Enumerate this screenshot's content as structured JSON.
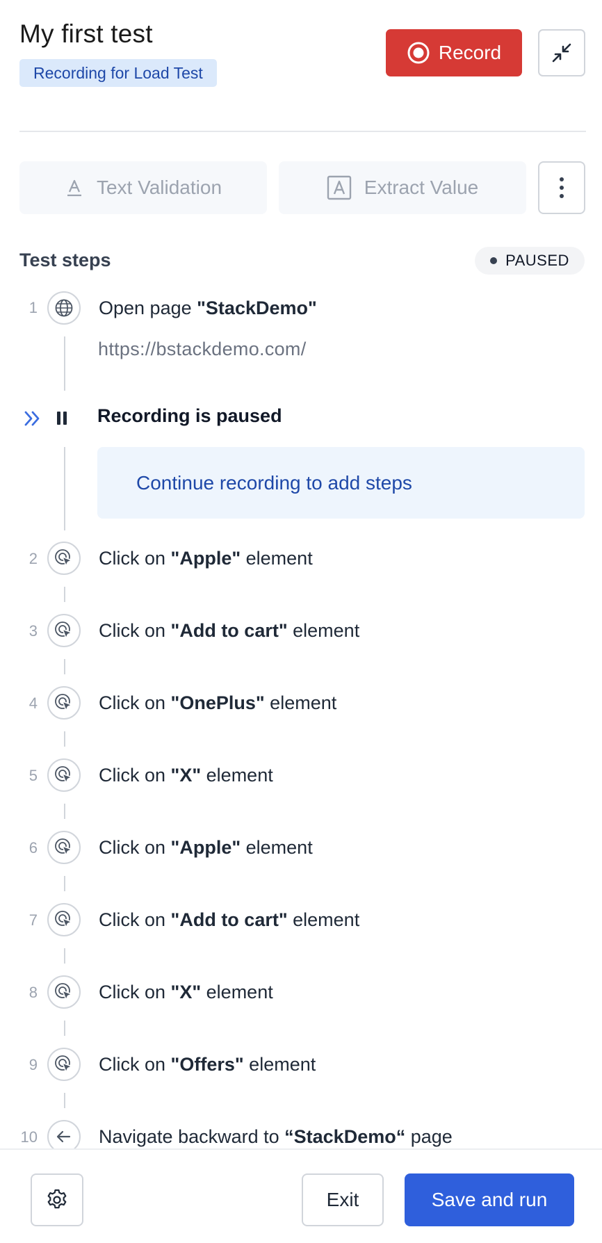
{
  "header": {
    "title": "My first test",
    "badge": "Recording for Load Test",
    "record_label": "Record",
    "record_color": "#d63a35"
  },
  "toolbar": {
    "text_validation_label": "Text Validation",
    "extract_value_label": "Extract Value",
    "more_icon": "vertical-dots-icon"
  },
  "steps_section": {
    "title": "Test steps",
    "status": "PAUSED"
  },
  "first_step": {
    "number": "1",
    "icon": "globe-icon",
    "prefix": "Open page ",
    "target": "\"StackDemo\"",
    "url": "https://bstackdemo.com/"
  },
  "paused": {
    "label": "Recording is paused",
    "continue_text": "Continue recording to add steps"
  },
  "steps": [
    {
      "number": "2",
      "icon": "click-cursor-icon",
      "prefix": "Click on ",
      "target": "\"Apple\"",
      "suffix": " element"
    },
    {
      "number": "3",
      "icon": "click-cursor-icon",
      "prefix": "Click on ",
      "target": "\"Add to cart\"",
      "suffix": " element"
    },
    {
      "number": "4",
      "icon": "click-cursor-icon",
      "prefix": "Click on ",
      "target": "\"OnePlus\"",
      "suffix": " element"
    },
    {
      "number": "5",
      "icon": "click-cursor-icon",
      "prefix": "Click on ",
      "target": "\"X\"",
      "suffix": " element"
    },
    {
      "number": "6",
      "icon": "click-cursor-icon",
      "prefix": "Click on ",
      "target": "\"Apple\"",
      "suffix": " element"
    },
    {
      "number": "7",
      "icon": "click-cursor-icon",
      "prefix": "Click on ",
      "target": "\"Add to cart\"",
      "suffix": " element"
    },
    {
      "number": "8",
      "icon": "click-cursor-icon",
      "prefix": "Click on ",
      "target": "\"X\"",
      "suffix": " element"
    },
    {
      "number": "9",
      "icon": "click-cursor-icon",
      "prefix": "Click on ",
      "target": "\"Offers\"",
      "suffix": " element"
    },
    {
      "number": "10",
      "icon": "arrow-left-icon",
      "prefix": "Navigate backward to ",
      "target": "“StackDemo“",
      "suffix": " page"
    }
  ],
  "footer": {
    "settings_icon": "gear-icon",
    "exit_label": "Exit",
    "save_label": "Save and run",
    "save_color": "#2f5fdc"
  }
}
